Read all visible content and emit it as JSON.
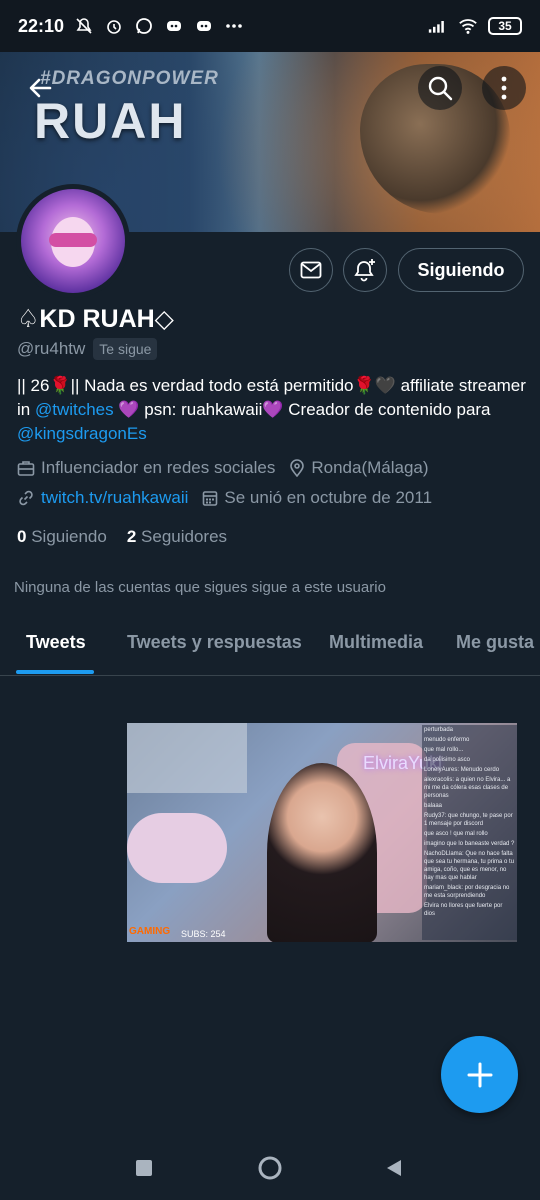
{
  "status_bar": {
    "time": "22:10",
    "battery": "35",
    "icons": [
      "muted-icon",
      "alarm-icon",
      "whatsapp-icon",
      "discord-icon",
      "discord-icon",
      "more-notifications-icon",
      "signal-icon",
      "wifi-icon",
      "battery-icon"
    ]
  },
  "banner": {
    "tag": "#DRAGONPOWER",
    "name": "RUAH"
  },
  "profile": {
    "display_name": "♤KD RUAH◇",
    "handle": "@ru4htw",
    "follows_you": "Te sigue",
    "bio_parts": {
      "p1": "|| 26🌹|| Nada es verdad todo está permitido🌹🖤  affiliate streamer in ",
      "link1": "@twitches",
      "p2": " 💜  psn: ruahkawaii💜  Creador de contenido para ",
      "link2": "@kingsdragonEs"
    },
    "category": "Influenciador en redes sociales",
    "location": "Ronda(Málaga)",
    "website": "twitch.tv/ruahkawaii",
    "joined": "Se unió en octubre de 2011",
    "following_count": "0",
    "following_label": "Siguiendo",
    "followers_count": "2",
    "followers_label": "Seguidores",
    "mutual_note": "Ninguna de las cuentas que sigues sigue a este usuario"
  },
  "actions": {
    "follow_label": "Siguiendo"
  },
  "tabs": [
    {
      "label": "Tweets",
      "active": true
    },
    {
      "label": "Tweets y respuestas",
      "active": false
    },
    {
      "label": "Multimedia",
      "active": false
    },
    {
      "label": "Me gusta",
      "active": false
    }
  ],
  "media": {
    "streamer_name": "ElviraYuki",
    "gaming_label": "GAMING",
    "subs_label": "SUBS: 254",
    "chat_lines": [
      "perturbada",
      "menudo enfermo",
      "que mal rollo...",
      "da pollisimo asco",
      "LonelyAures: Menudo cerdo",
      "alexracolis: a quien no Elvira... a mi me da cólera esas clases de personas",
      "balaaa",
      "Rudy37: que chungo, te pase por 1 mensaje por discord",
      "que asco ! que mal rollo",
      "imagino que lo baneaste verdad ?",
      "NachoDLlama: Que no hace falta que sea tu hermana, tu prima o tu amiga, coño, que es menor, no hay mas que hablar",
      "mariam_black: por desgracia no me esta sorprendiendo",
      "Elvira no llores que fuerte por dios"
    ]
  },
  "colors": {
    "background": "#15202b",
    "accent": "#1d9bf0",
    "secondary_text": "#8b98a5",
    "border": "#536471"
  }
}
